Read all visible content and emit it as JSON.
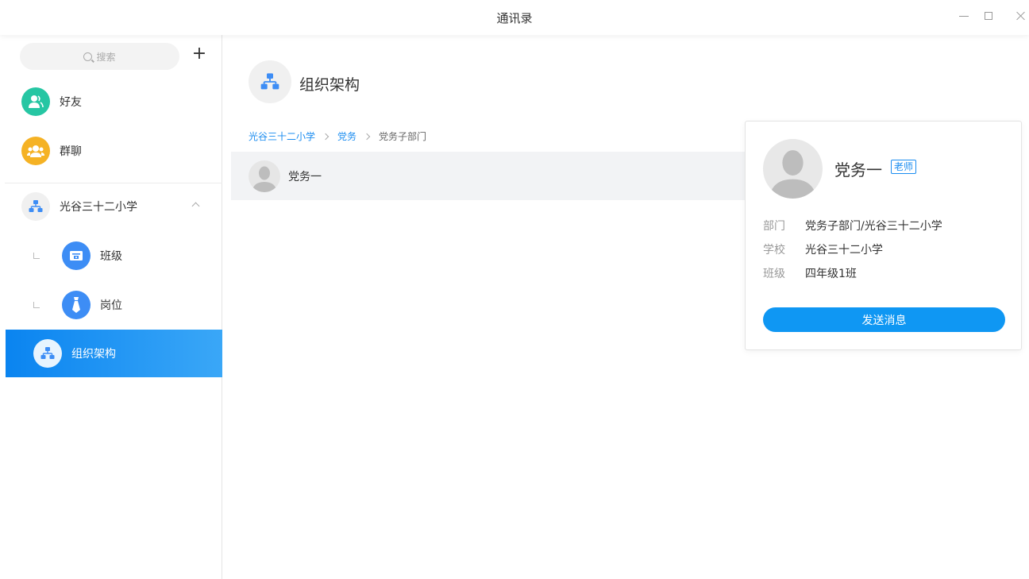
{
  "window": {
    "title": "通讯录"
  },
  "sidebar": {
    "search_placeholder": "搜索",
    "add_label": "+",
    "friends_label": "好友",
    "groups_label": "群聊",
    "school_label": "光谷三十二小学",
    "class_label": "班级",
    "post_label": "岗位",
    "org_label": "组织架构"
  },
  "main": {
    "title": "组织架构",
    "breadcrumb": [
      "光谷三十二小学",
      "党务",
      "党务子部门"
    ],
    "members": [
      {
        "name": "党务一"
      }
    ]
  },
  "card": {
    "name": "党务一",
    "role": "老师",
    "fields": [
      {
        "label": "部门",
        "value": "党务子部门/光谷三十二小学"
      },
      {
        "label": "学校",
        "value": "光谷三十二小学"
      },
      {
        "label": "班级",
        "value": "四年级1班"
      }
    ],
    "send_button": "发送消息"
  },
  "colors": {
    "accent": "#1a8cf0",
    "friends_icon": "#26c6a3",
    "groups_icon": "#f5b224",
    "nav_icon_blue": "#3d8df5"
  },
  "icons": {
    "friends": "friends-icon",
    "groups": "group-chat-icon",
    "org": "org-chart-icon",
    "class": "class-icon",
    "post": "post-icon"
  }
}
